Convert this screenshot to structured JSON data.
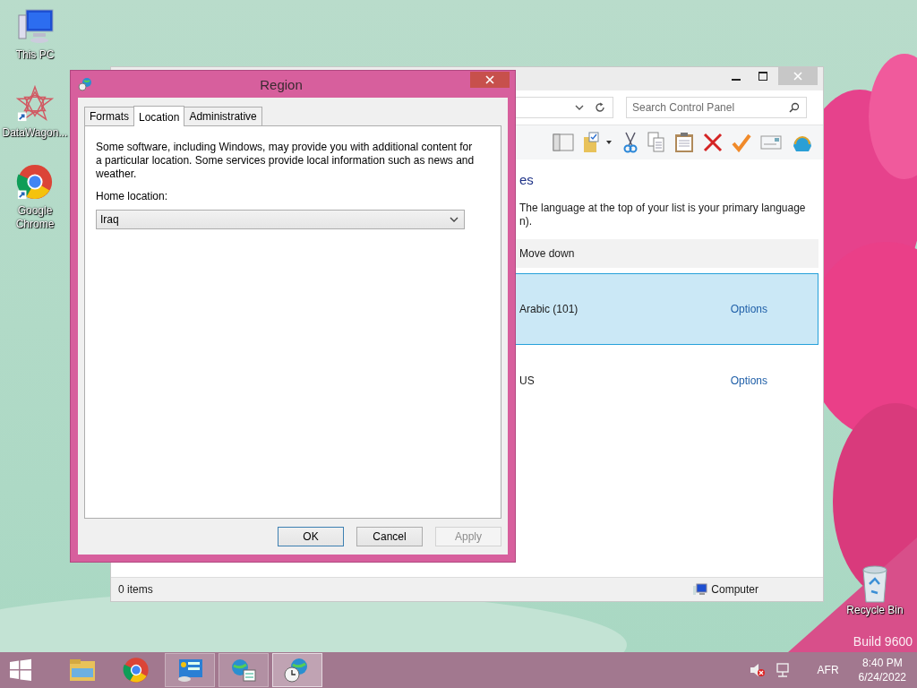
{
  "desktop": {
    "icons": [
      {
        "label": "This PC",
        "kind": "computer"
      },
      {
        "label": "DataWagon...",
        "kind": "star"
      },
      {
        "label": "Google Chrome",
        "kind": "chrome"
      },
      {
        "label": "Recycle Bin",
        "kind": "bin"
      }
    ],
    "watermark": "Build 9600"
  },
  "back_window": {
    "search": {
      "placeholder": "Search Control Panel"
    },
    "heading": "es",
    "description_lines": [
      "The language at the top of your list is your primary language",
      "n)."
    ],
    "command": "Move down",
    "languages": [
      {
        "name": "Arabic (101)",
        "options": "Options",
        "selected": true
      },
      {
        "name": "US",
        "options": "Options",
        "selected": false
      }
    ],
    "status_bar": {
      "items": "0 items",
      "location": "Computer"
    }
  },
  "dialog": {
    "title": "Region",
    "tabs": [
      {
        "label": "Formats",
        "selected": false
      },
      {
        "label": "Location",
        "selected": true
      },
      {
        "label": "Administrative",
        "selected": false
      }
    ],
    "intro": "Some software, including Windows, may provide you with additional content for a particular location. Some services provide local information such as news and weather.",
    "home_label": "Home location:",
    "home_value": "Iraq",
    "buttons": [
      {
        "label": "OK",
        "default": true,
        "disabled": false
      },
      {
        "label": "Cancel",
        "default": false,
        "disabled": false
      },
      {
        "label": "Apply",
        "default": false,
        "disabled": true
      }
    ]
  },
  "taskbar": {
    "apps": [
      {
        "kind": "explorer",
        "running": false,
        "selected": false
      },
      {
        "kind": "chrome",
        "running": false,
        "selected": false
      },
      {
        "kind": "control-panel",
        "running": true,
        "selected": false
      },
      {
        "kind": "language",
        "running": true,
        "selected": false
      },
      {
        "kind": "region",
        "running": true,
        "selected": true
      }
    ],
    "tray": {
      "language": "AFR",
      "time": "8:40 PM",
      "date": "6/24/2022"
    }
  }
}
